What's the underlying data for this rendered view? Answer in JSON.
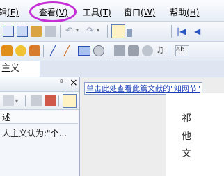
{
  "menubar": {
    "items": [
      {
        "label": "辑",
        "accel": "(E)"
      },
      {
        "label": "查看",
        "accel": "(V)"
      },
      {
        "label": "工具",
        "accel": "(T)"
      },
      {
        "label": "窗口",
        "accel": "(W)"
      },
      {
        "label": "帮助",
        "accel": "(H)"
      }
    ],
    "highlight_color": "#c62fd6"
  },
  "tabs": {
    "active_label": "主义"
  },
  "left_panel": {
    "pin_glyph": "ᵖ",
    "close_glyph": "×",
    "column_header": "述",
    "rows": [
      "人主义认为:\"个..."
    ]
  },
  "document": {
    "link_text": "单击此处查看此篇文献的\"知网节\"",
    "side_chars": [
      "祁",
      "他",
      "文"
    ]
  }
}
